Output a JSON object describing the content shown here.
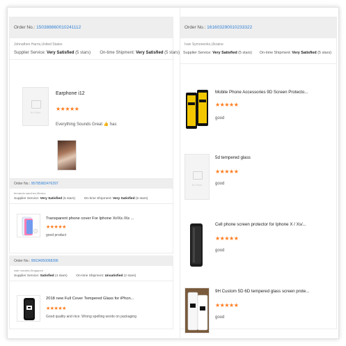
{
  "left": {
    "card1": {
      "order_label": "Order No.:",
      "order_no": "150388860010241112",
      "buyer": "Johnathen Harris,United States",
      "supplier_label": "Supplier Service:",
      "supplier_value": "Very Satisfied",
      "supplier_stars": "(5 stars)",
      "shipment_label": "On-time Shipment:",
      "shipment_value": "Very Satisfied",
      "shipment_stars": "(5 stars)",
      "product_title": "Earphone i12",
      "stars": "★★★★★",
      "comment": "Everything Sounds Great 👍 has",
      "thumb_text": "No Photo"
    },
    "card2": {
      "order_label": "Order No.:",
      "order_no": "95785982476297",
      "buyer": "fernando sanchez,Mexico",
      "supplier_label": "Supplier Service:",
      "supplier_value": "Very Satisfied",
      "supplier_stars": "(5 stars)",
      "shipment_label": "On-time Shipment:",
      "shipment_value": "Very Satisfied",
      "shipment_stars": "(5 stars)",
      "product_title": "Transparent phone cover For Iphone Xr/Xs /Xs ...",
      "stars": "★★★★★",
      "comment": "good product"
    },
    "card3": {
      "order_label": "Order No.:",
      "order_no": "95634050068396",
      "buyer": "wah morales,Singapore",
      "supplier_label": "Supplier Service:",
      "supplier_value": "Satisfied",
      "supplier_stars": "(4 stars)",
      "shipment_label": "On-time Shipment:",
      "shipment_value": "Unsatisfied",
      "shipment_stars": "(2 stars)",
      "product_title": "2018 new Full Cover Tempered Glass for iPhon...",
      "stars": "★★★★★",
      "comment": "Good quality and nice. Wrong spelling words on packaging"
    }
  },
  "right": {
    "order_label": "Order No.:",
    "order_no": "161603290010233322",
    "buyer": "Ivan Symonenko,Ukraine",
    "supplier_label": "Supplier Service:",
    "supplier_value": "Very Satisfied",
    "supplier_stars": "(5 stars)",
    "shipment_label": "On-time Shipment:",
    "shipment_value": "Very Satisfied",
    "shipment_stars": "(5 stars)",
    "items": [
      {
        "title": "Mobile Phone Accessories 9D Screen Protecto...",
        "stars": "★★★★★",
        "comment": "good"
      },
      {
        "title": "5d tempered glass",
        "stars": "★★★★★",
        "comment": "good",
        "thumb_text": "No Photo"
      },
      {
        "title": "Cell phone screen protector for Iphone X / Xs/...",
        "stars": "★★★★★",
        "comment": "good"
      },
      {
        "title": "9H Custom 5D 6D tempered glass screen prote...",
        "stars": "★★★★★",
        "comment": "good"
      }
    ]
  },
  "colors": {
    "star": "#ff7a1a",
    "order_link": "#2f7fd4",
    "bar_bg": "#eeeeee"
  }
}
